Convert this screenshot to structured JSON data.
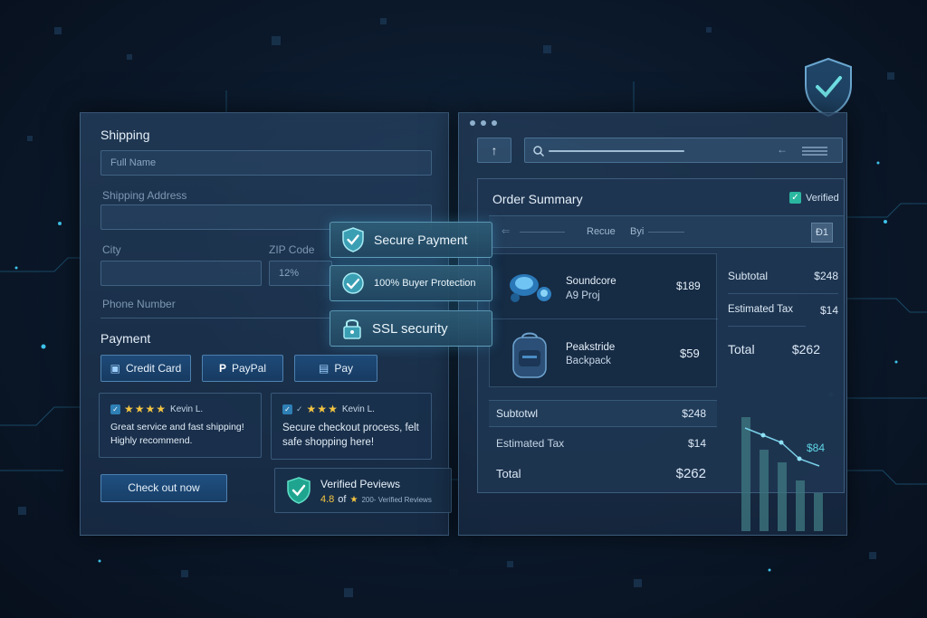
{
  "shipping": {
    "title": "Shipping",
    "full_name_placeholder": "Full Name",
    "address_label": "Shipping Address",
    "city_label": "City",
    "zip_label": "ZIP Code",
    "zip_value": "12%",
    "phone_label": "Phone Number"
  },
  "payment": {
    "title": "Payment",
    "methods": [
      {
        "label": "Credit Card",
        "icon": "card-icon"
      },
      {
        "label": "PayPal",
        "icon": "paypal-icon"
      },
      {
        "label": "Pay",
        "icon": "pay-icon"
      }
    ]
  },
  "reviews": [
    {
      "author": "Kevin L.",
      "stars": 4,
      "text": "Great service and fast shipping! Highly recommend."
    },
    {
      "author": "Kevin L.",
      "stars": 3,
      "text": "Secure checkout process, felt safe shopping here!"
    }
  ],
  "checkout_button": "Check out now",
  "verified_reviews": {
    "title": "Verified Peviews",
    "rating": "4.8",
    "of": "of",
    "count_text": "200- Verified Reviews"
  },
  "security_badges": [
    {
      "label": "Secure Payment",
      "icon": "shield-check-icon"
    },
    {
      "label": "100% Buyer Protection",
      "icon": "protection-icon"
    },
    {
      "label": "SSL security",
      "icon": "lock-icon"
    }
  ],
  "order_summary": {
    "title": "Order Summary",
    "verified_label": "Verified",
    "toolbar": {
      "text1": "Recue",
      "text2": "Byi",
      "box": "Ɖ1"
    },
    "products": [
      {
        "name1": "Soundcore",
        "name2": "A9 Proj",
        "price": "$189"
      },
      {
        "name1": "Peakstride",
        "name2": "Backpack",
        "price": "$59"
      }
    ],
    "subtotal_label": "Subtotwl",
    "subtotal_value": "$248",
    "tax_label": "Estimated Tax",
    "tax_value": "$14",
    "total_label": "Total",
    "total_value": "$262",
    "side": {
      "subtotal_label": "Subtotal",
      "subtotal_value": "$248",
      "tax_label": "Estimated Tax",
      "tax_value": "$14",
      "total_label": "Total",
      "total_value": "$262"
    },
    "chart_value": "$84"
  },
  "colors": {
    "accent": "#4fd2ea",
    "star": "#f4c542",
    "verified_green": "#2ab7a0",
    "panel_border": "#78aad2"
  }
}
